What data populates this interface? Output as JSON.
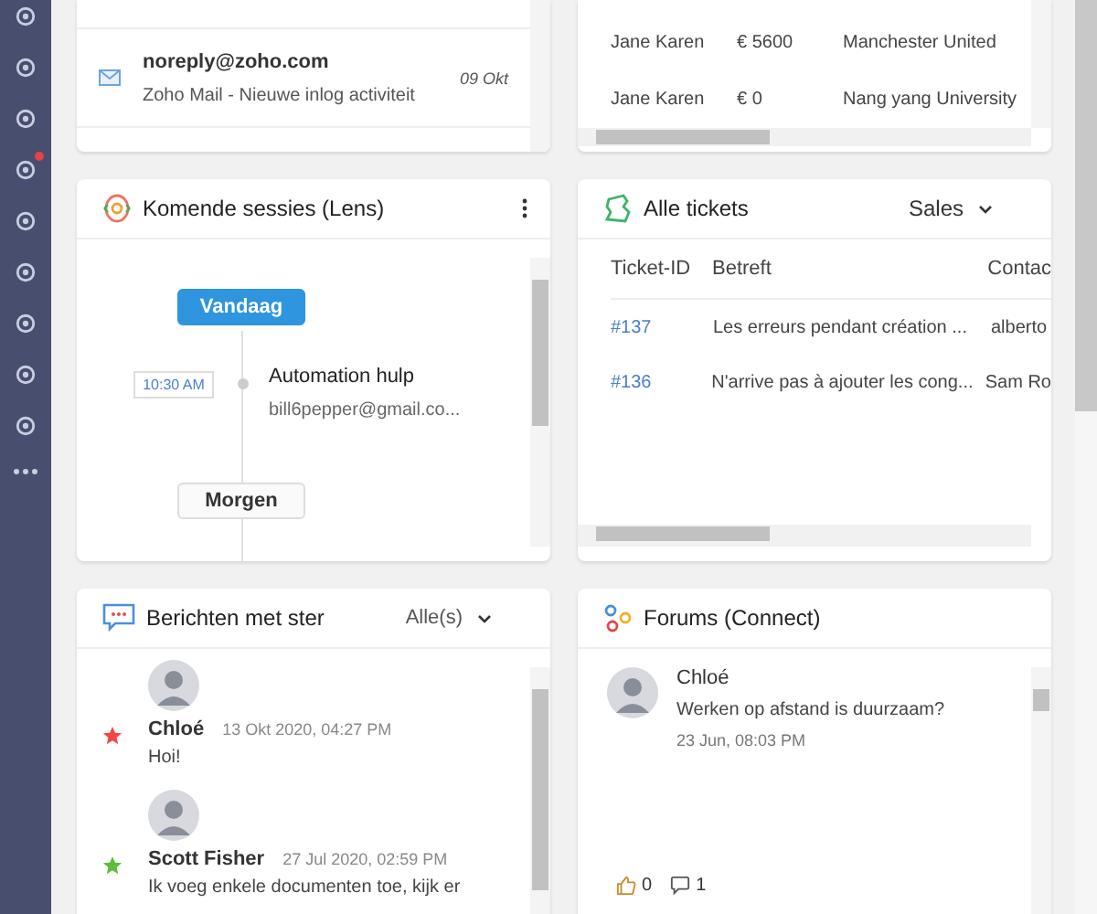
{
  "sidebar": {
    "items": [
      {
        "badge": false
      },
      {
        "badge": false
      },
      {
        "badge": false
      },
      {
        "badge": true
      },
      {
        "badge": false
      },
      {
        "badge": false
      },
      {
        "badge": false
      },
      {
        "badge": false
      },
      {
        "badge": false
      }
    ]
  },
  "mail_card": {
    "items": [
      {
        "sender": "noreply@zoho.com",
        "subject": "Zoho Mail - Nieuwe inlog activiteit",
        "date": "09 Okt"
      }
    ]
  },
  "deals_card": {
    "rows": [
      [
        "Jane Karen",
        "€ 5600",
        "Manchester United"
      ],
      [
        "Jane Karen",
        "€ 0",
        "Nang yang University"
      ]
    ]
  },
  "sessions_card": {
    "title": "Komende sessies (Lens)",
    "groups": [
      {
        "label": "Vandaag",
        "selected": true,
        "sessions": [
          {
            "time": "10:30 AM",
            "title": "Automation hulp",
            "email": "bill6pepper@gmail.co..."
          }
        ]
      },
      {
        "label": "Morgen",
        "selected": false
      }
    ]
  },
  "tickets_card": {
    "title": "Alle tickets",
    "filter": "Sales",
    "columns": [
      "Ticket-ID",
      "Betreft",
      "Contac"
    ],
    "rows": [
      [
        "#137",
        "Les erreurs pendant création ...",
        "alberto"
      ],
      [
        "#136",
        "N'arrive pas à ajouter les cong...",
        "Sam Ro"
      ]
    ]
  },
  "starred_card": {
    "title": "Berichten met ster",
    "filter": "Alle(s)",
    "messages": [
      {
        "author": "Chloé",
        "time": "13 Okt 2020, 04:27 PM",
        "text": "Hoi!",
        "color": "#f04848"
      },
      {
        "author": "Scott Fisher",
        "time": "27 Jul 2020, 02:59 PM",
        "text": "Ik voeg enkele documenten toe, kijk er",
        "color": "#5cbd3c"
      }
    ]
  },
  "forums_card": {
    "title": "Forums (Connect)",
    "posts": [
      {
        "author": "Chloé",
        "text": "Werken op afstand is duurzaam?",
        "time": "23 Jun, 08:03 PM",
        "likes": "0",
        "comments": "1"
      }
    ]
  }
}
